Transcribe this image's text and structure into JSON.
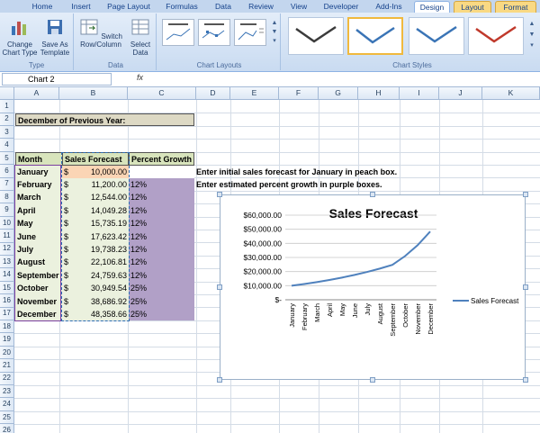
{
  "tabs": [
    "Home",
    "Insert",
    "Page Layout",
    "Formulas",
    "Data",
    "Review",
    "View",
    "Developer",
    "Add-Ins",
    "Design",
    "Layout",
    "Format"
  ],
  "ribbon": {
    "type_group": {
      "label": "Type",
      "change_chart_type": "Change Chart Type",
      "save_as_template": "Save As Template"
    },
    "data_group": {
      "label": "Data",
      "switch_row_column": "Switch Row/Column",
      "select_data": "Select Data"
    },
    "layouts_label": "Chart Layouts",
    "styles_label": "Chart Styles",
    "style_colors": [
      "#3b3b3b",
      "#3a74b6",
      "#3a74b6",
      "#c0392b"
    ]
  },
  "formula_bar": {
    "name_box": "Chart 2",
    "fx": "fx"
  },
  "columns": [
    "A",
    "B",
    "C",
    "D",
    "E",
    "F",
    "G",
    "H",
    "I",
    "J",
    "K"
  ],
  "rows": [
    "1",
    "2",
    "3",
    "4",
    "5",
    "6",
    "7",
    "8",
    "9",
    "10",
    "11",
    "12",
    "13",
    "14",
    "15",
    "16",
    "17",
    "18",
    "19",
    "20",
    "21",
    "22",
    "23",
    "24",
    "25",
    "26"
  ],
  "sheet": {
    "title": "December of Previous Year:",
    "headers": {
      "month": "Month",
      "forecast": "Sales Forecast",
      "growth": "Percent Growth"
    },
    "rows": [
      {
        "month": "January",
        "cur": "$",
        "value": "10,000.00",
        "growth": ""
      },
      {
        "month": "February",
        "cur": "$",
        "value": "11,200.00",
        "growth": "12%"
      },
      {
        "month": "March",
        "cur": "$",
        "value": "12,544.00",
        "growth": "12%"
      },
      {
        "month": "April",
        "cur": "$",
        "value": "14,049.28",
        "growth": "12%"
      },
      {
        "month": "May",
        "cur": "$",
        "value": "15,735.19",
        "growth": "12%"
      },
      {
        "month": "June",
        "cur": "$",
        "value": "17,623.42",
        "growth": "12%"
      },
      {
        "month": "July",
        "cur": "$",
        "value": "19,738.23",
        "growth": "12%"
      },
      {
        "month": "August",
        "cur": "$",
        "value": "22,106.81",
        "growth": "12%"
      },
      {
        "month": "September",
        "cur": "$",
        "value": "24,759.63",
        "growth": "12%"
      },
      {
        "month": "October",
        "cur": "$",
        "value": "30,949.54",
        "growth": "25%"
      },
      {
        "month": "November",
        "cur": "$",
        "value": "38,686.92",
        "growth": "25%"
      },
      {
        "month": "December",
        "cur": "$",
        "value": "48,358.66",
        "growth": "25%"
      }
    ],
    "note1": "Enter initial sales forecast for January in peach box.",
    "note2": "Enter estimated percent growth in purple boxes.",
    "colors": {
      "peach": "#fbd5b5",
      "purple": "#b1a0c7",
      "header_green": "#d8e4bc",
      "title_tan": "#ddd9c4",
      "month_green": "#ebf1de"
    }
  },
  "chart_data": {
    "type": "line",
    "title": "Sales Forecast",
    "categories": [
      "January",
      "February",
      "March",
      "April",
      "May",
      "June",
      "July",
      "August",
      "September",
      "October",
      "November",
      "December"
    ],
    "series": [
      {
        "name": "Sales Forecast",
        "values": [
          10000,
          11200,
          12544,
          14049.28,
          15735.19,
          17623.42,
          19738.23,
          22106.81,
          24759.63,
          30949.54,
          38686.92,
          48358.66
        ]
      }
    ],
    "ylim": [
      0,
      60000
    ],
    "yticks": [
      "$-",
      "$10,000.00",
      "$20,000.00",
      "$30,000.00",
      "$40,000.00",
      "$50,000.00",
      "$60,000.00"
    ],
    "legend": "right",
    "grid": true,
    "line_color": "#4f81bd"
  }
}
